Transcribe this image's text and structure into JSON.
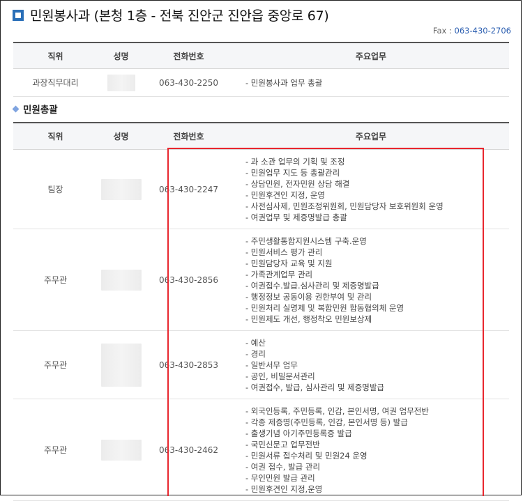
{
  "header": {
    "title": "민원봉사과 (본청 1층 - 전북 진안군 진안읍 중앙로 67)",
    "fax_label": "Fax : ",
    "fax_number": "063-430-2706"
  },
  "columns": {
    "position": "직위",
    "name": "성명",
    "phone": "전화번호",
    "duty": "주요업무"
  },
  "table1": {
    "rows": [
      {
        "position": "과장직무대리",
        "phone": "063-430-2250",
        "duties": [
          "- 민원봉사과 업무  총괄"
        ]
      }
    ]
  },
  "section2": {
    "title": "민원총괄"
  },
  "table2": {
    "rows": [
      {
        "position": "팀장",
        "phone": "063-430-2247",
        "duties": [
          "- 과 소관 업무의 기획 및 조정",
          "- 민원업무 지도 등 총괄관리",
          "- 상담민원, 전자민원 상담 해결",
          "- 민원후견인 지정, 운영",
          "- 사전심사제, 민원조정위원회, 민원담당자 보호위원회 운영",
          "- 여권업무 및 제증명발급 총괄"
        ]
      },
      {
        "position": "주무관",
        "phone": "063-430-2856",
        "duties": [
          "- 주민생활통합지원시스템 구축.운영",
          "- 민원서비스 평가 관리",
          "- 민원담당자 교육 및 지원",
          "- 가족관계업무 관리",
          "- 여권접수.발급.심사관리 및 제증명발급",
          "- 행정정보 공동이용 권한부여 및 관리",
          "- 민원처리 실명제 및 복합민원 합동협의체 운영",
          "- 민원제도 개선, 행정착오 민원보상제"
        ]
      },
      {
        "position": "주무관",
        "phone": "063-430-2853",
        "duties": [
          "- 예산",
          "- 경리",
          "- 일반서무 업무",
          "- 공인, 비밀문서관리",
          "- 여권접수, 발급, 심사관리 및 제증명발급"
        ]
      },
      {
        "position": "주무관",
        "phone": "063-430-2462",
        "duties": [
          "- 외국인등록, 주민등록, 인감, 본인서명, 여권 업무전반",
          "- 각종 제증명(주민등록, 인감, 본인서명 등) 발급",
          "- 출생기념 아기주민등록증 발급",
          "- 국민신문고 업무전반",
          "- 민원서류 접수처리 및 민원24 운영",
          "- 여권 접수, 발급 관리",
          "- 무인민원 발급 관리",
          "- 민원후견인 지정,운영"
        ]
      }
    ]
  }
}
